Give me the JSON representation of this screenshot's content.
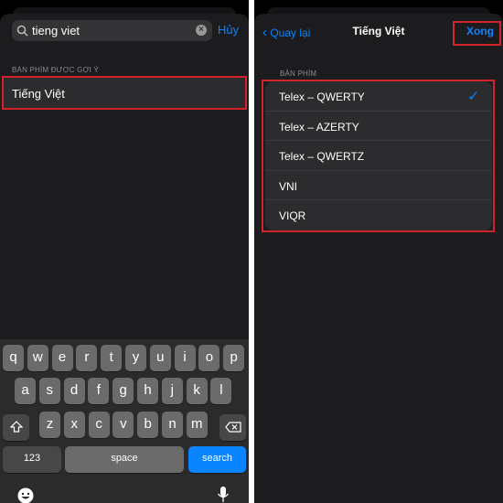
{
  "left": {
    "search": {
      "value": "tieng viet",
      "cancel_label": "Hủy"
    },
    "section_header": "BÀN PHÍM ĐƯỢC GỢI Ý",
    "suggestion": "Tiếng Việt",
    "keyboard": {
      "row1": [
        "q",
        "w",
        "e",
        "r",
        "t",
        "y",
        "u",
        "i",
        "o",
        "p"
      ],
      "row2": [
        "a",
        "s",
        "d",
        "f",
        "g",
        "h",
        "j",
        "k",
        "l"
      ],
      "row3": [
        "z",
        "x",
        "c",
        "v",
        "b",
        "n",
        "m"
      ],
      "numbers_label": "123",
      "space_label": "space",
      "search_label": "search"
    }
  },
  "right": {
    "back_label": "Quay lại",
    "title": "Tiếng Việt",
    "done_label": "Xong",
    "section_header": "BÀN PHÍM",
    "layouts": [
      {
        "label": "Telex – QWERTY",
        "selected": true
      },
      {
        "label": "Telex – AZERTY",
        "selected": false
      },
      {
        "label": "Telex – QWERTZ",
        "selected": false
      },
      {
        "label": "VNI",
        "selected": false
      },
      {
        "label": "VIQR",
        "selected": false
      }
    ]
  },
  "colors": {
    "accent": "#0a84ff",
    "highlight": "#d2232a"
  }
}
